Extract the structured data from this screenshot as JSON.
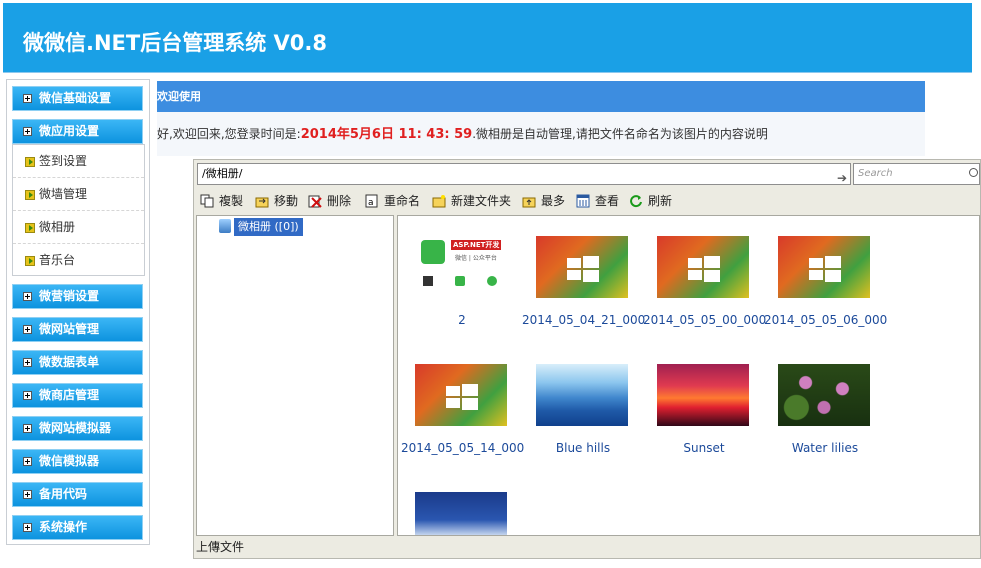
{
  "header": {
    "title": "微微信.NET后台管理系统 V0.8"
  },
  "sidebar": {
    "items": [
      {
        "label": "微信基础设置"
      },
      {
        "label": "微应用设置"
      },
      {
        "label": "微营销设置"
      },
      {
        "label": "微网站管理"
      },
      {
        "label": "微数据表单"
      },
      {
        "label": "微商店管理"
      },
      {
        "label": "微网站模拟器"
      },
      {
        "label": "微信模拟器"
      },
      {
        "label": "备用代码"
      },
      {
        "label": "系统操作"
      }
    ],
    "sub_items": [
      {
        "label": "签到设置"
      },
      {
        "label": "微墙管理"
      },
      {
        "label": "微相册"
      },
      {
        "label": "音乐台"
      }
    ]
  },
  "main": {
    "welcome": "欢迎使用",
    "greeting_prefix": "好,欢迎回来,您登录时间是:",
    "login_time": "2014年5月6日 11: 43: 59",
    "greeting_suffix": ".微相册是自动管理,请把文件名命名为该图片的内容说明"
  },
  "file_manager": {
    "path": "/微相册/",
    "search_placeholder": "Search",
    "toolbar": [
      "複製",
      "移動",
      "刪除",
      "重命名",
      "新建文件夹",
      "最多",
      "查看",
      "刷新"
    ],
    "tree_node": "微相册 ([0])",
    "files": [
      {
        "name": "2",
        "thumb": "qr-icon",
        "qr_title": "ASP.NET开发",
        "qr_sub": "微信 | 公众平台"
      },
      {
        "name": "2014_05_04_21_000",
        "thumb": "windows-wallpaper"
      },
      {
        "name": "2014_05_05_00_000",
        "thumb": "windows-wallpaper"
      },
      {
        "name": "2014_05_05_06_000",
        "thumb": "windows-wallpaper"
      },
      {
        "name": "2014_05_05_14_000",
        "thumb": "windows-wallpaper"
      },
      {
        "name": "Blue hills",
        "thumb": "blue-hills"
      },
      {
        "name": "Sunset",
        "thumb": "sunset"
      },
      {
        "name": "Water lilies",
        "thumb": "water-lilies"
      },
      {
        "name": "",
        "thumb": "winter"
      }
    ],
    "upload": "上傳文件"
  },
  "colors": {
    "header": "#1aa0e6",
    "menu": "#0d93df",
    "welcome": "#3d8de0",
    "time": "#e02020",
    "link": "#1c4a9a"
  }
}
